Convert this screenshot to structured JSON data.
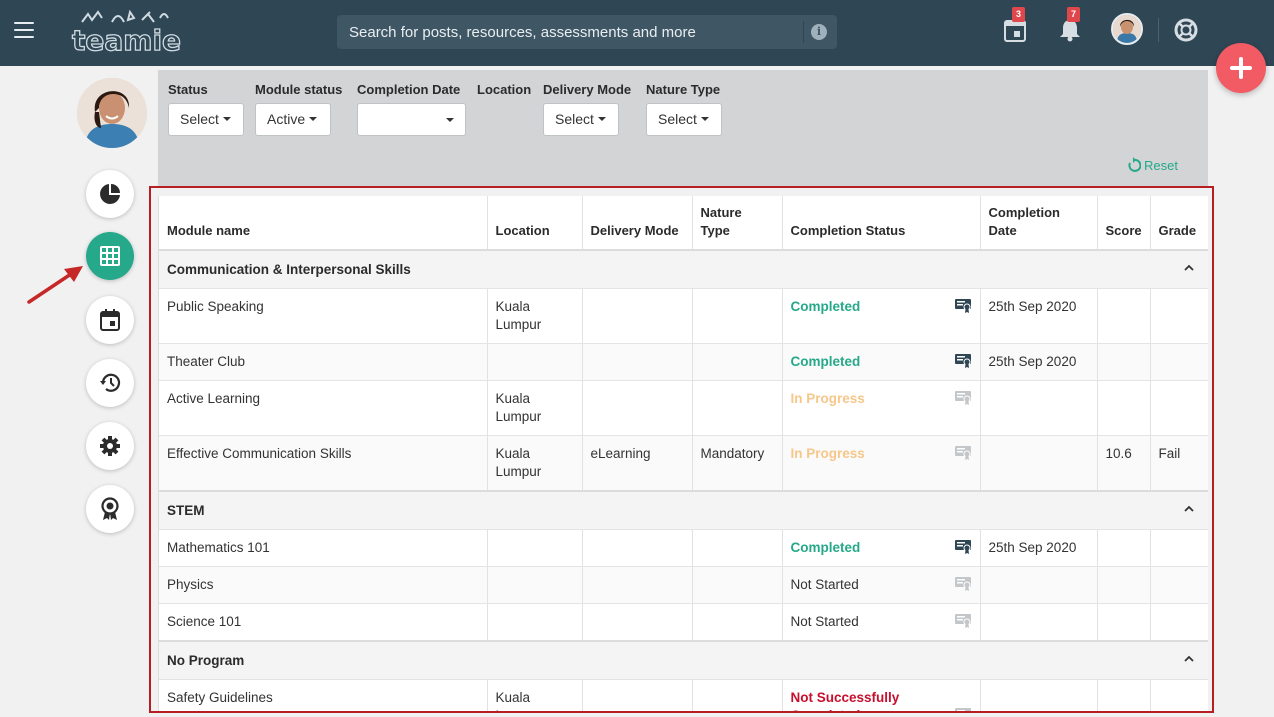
{
  "navbar": {
    "logo_text": "teamie",
    "search_placeholder": "Search for posts, resources, assessments and more",
    "calendar_badge": "3",
    "notifications_badge": "7",
    "icons": [
      "menu-icon",
      "calendar-icon",
      "bell-icon",
      "help-icon",
      "info-icon"
    ],
    "bg_color": "#2f4655"
  },
  "filters": {
    "status": {
      "label": "Status",
      "value": "Select"
    },
    "module_status": {
      "label": "Module status",
      "value": "Active"
    },
    "completion_date": {
      "label": "Completion Date",
      "value": ""
    },
    "location": {
      "label": "Location"
    },
    "delivery_mode": {
      "label": "Delivery Mode",
      "value": "Select"
    },
    "nature_type": {
      "label": "Nature Type",
      "value": "Select"
    },
    "reset_label": "Reset"
  },
  "table": {
    "headers": {
      "module": "Module name",
      "location": "Location",
      "delivery": "Delivery Mode",
      "nature": "Nature Type",
      "status": "Completion Status",
      "date": "Completion Date",
      "score": "Score",
      "grade": "Grade"
    },
    "groups": [
      {
        "name": "Communication & Interpersonal Skills",
        "rows": [
          {
            "module": "Public Speaking",
            "location": "Kuala Lumpur",
            "delivery": "",
            "nature": "",
            "status": "Completed",
            "date": "25th Sep 2020",
            "score": "",
            "grade": ""
          },
          {
            "module": "Theater Club",
            "location": "",
            "delivery": "",
            "nature": "",
            "status": "Completed",
            "date": "25th Sep 2020",
            "score": "",
            "grade": ""
          },
          {
            "module": "Active Learning",
            "location": "Kuala Lumpur",
            "delivery": "",
            "nature": "",
            "status": "In Progress",
            "date": "",
            "score": "",
            "grade": ""
          },
          {
            "module": "Effective Communication Skills",
            "location": "Kuala Lumpur",
            "delivery": "eLearning",
            "nature": "Mandatory",
            "status": "In Progress",
            "date": "",
            "score": "10.6",
            "grade": "Fail"
          }
        ]
      },
      {
        "name": "STEM",
        "rows": [
          {
            "module": "Mathematics 101",
            "location": "",
            "delivery": "",
            "nature": "",
            "status": "Completed",
            "date": "25th Sep 2020",
            "score": "",
            "grade": ""
          },
          {
            "module": "Physics",
            "location": "",
            "delivery": "",
            "nature": "",
            "status": "Not Started",
            "date": "",
            "score": "",
            "grade": ""
          },
          {
            "module": "Science 101",
            "location": "",
            "delivery": "",
            "nature": "",
            "status": "Not Started",
            "date": "",
            "score": "",
            "grade": ""
          }
        ]
      },
      {
        "name": "No Program",
        "rows": [
          {
            "module": "Safety Guidelines",
            "location": "Kuala Lumpur",
            "delivery": "",
            "nature": "",
            "status": "Not Successfully Completed",
            "date": "",
            "score": "",
            "grade": ""
          }
        ]
      }
    ]
  },
  "colors": {
    "accent": "#26a98a",
    "completed": "#26a98a",
    "in_progress": "#f6c78a",
    "not_successful": "#c8102e",
    "highlight_frame": "#b51f24",
    "fab": "#f25a64"
  }
}
